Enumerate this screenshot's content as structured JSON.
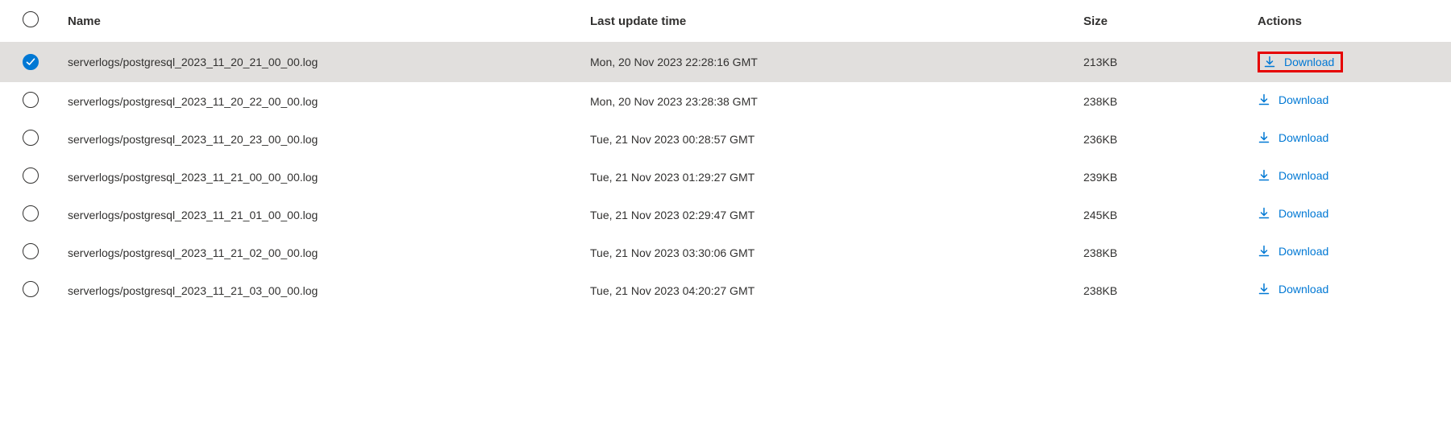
{
  "columns": {
    "name": "Name",
    "last_update": "Last update time",
    "size": "Size",
    "actions": "Actions"
  },
  "download_label": "Download",
  "rows": [
    {
      "selected": true,
      "callout": true,
      "name": "serverlogs/postgresql_2023_11_20_21_00_00.log",
      "last_update": "Mon, 20 Nov 2023 22:28:16 GMT",
      "size": "213KB"
    },
    {
      "selected": false,
      "callout": false,
      "name": "serverlogs/postgresql_2023_11_20_22_00_00.log",
      "last_update": "Mon, 20 Nov 2023 23:28:38 GMT",
      "size": "238KB"
    },
    {
      "selected": false,
      "callout": false,
      "name": "serverlogs/postgresql_2023_11_20_23_00_00.log",
      "last_update": "Tue, 21 Nov 2023 00:28:57 GMT",
      "size": "236KB"
    },
    {
      "selected": false,
      "callout": false,
      "name": "serverlogs/postgresql_2023_11_21_00_00_00.log",
      "last_update": "Tue, 21 Nov 2023 01:29:27 GMT",
      "size": "239KB"
    },
    {
      "selected": false,
      "callout": false,
      "name": "serverlogs/postgresql_2023_11_21_01_00_00.log",
      "last_update": "Tue, 21 Nov 2023 02:29:47 GMT",
      "size": "245KB"
    },
    {
      "selected": false,
      "callout": false,
      "name": "serverlogs/postgresql_2023_11_21_02_00_00.log",
      "last_update": "Tue, 21 Nov 2023 03:30:06 GMT",
      "size": "238KB"
    },
    {
      "selected": false,
      "callout": false,
      "name": "serverlogs/postgresql_2023_11_21_03_00_00.log",
      "last_update": "Tue, 21 Nov 2023 04:20:27 GMT",
      "size": "238KB"
    }
  ]
}
